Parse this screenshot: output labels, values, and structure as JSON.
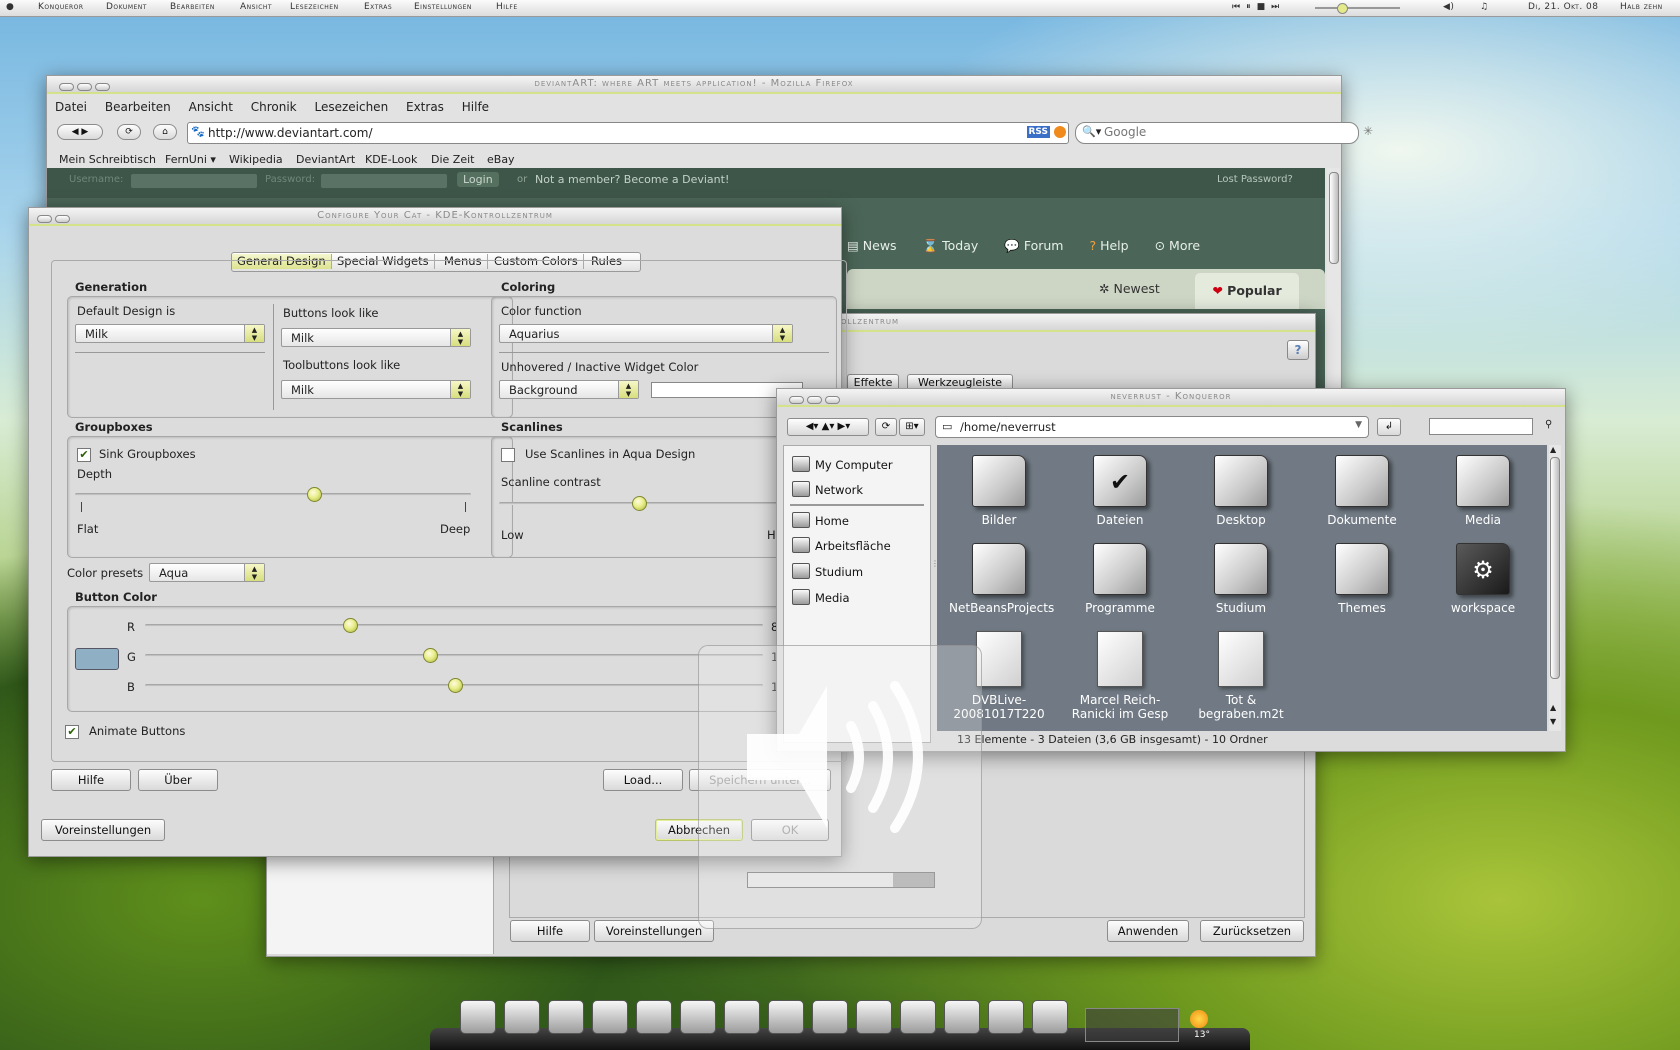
{
  "menubar": {
    "items": [
      "Konqueror",
      "Dokument",
      "Bearbeiten",
      "Ansicht",
      "Lesezeichen",
      "Extras",
      "Einstellungen",
      "Hilfe"
    ],
    "clock": "Di, 21. Okt. 08",
    "clock2": "Halb zehn"
  },
  "firefox": {
    "title": "deviantART: where ART meets application! - Mozilla Firefox",
    "menus": [
      "Datei",
      "Bearbeiten",
      "Ansicht",
      "Chronik",
      "Lesezeichen",
      "Extras",
      "Hilfe"
    ],
    "url": "http://www.deviantart.com/",
    "rss": "RSS",
    "search_placeholder": "Google",
    "bookmarks": [
      "Mein Schreibtisch",
      "FernUni ▾",
      "Wikipedia",
      "DeviantArt",
      "KDE-Look",
      "Die Zeit",
      "eBay"
    ],
    "login": {
      "username": "Username:",
      "password": "Password:",
      "button": "Login",
      "or": "or",
      "member": "Not a member? Become a Deviant!",
      "lost": "Lost Password?"
    },
    "nav": [
      "News",
      "Today",
      "Forum",
      "Help",
      "More"
    ],
    "tabs": [
      "Newest",
      "Popular"
    ]
  },
  "kcontrol_bg": {
    "title_fragment": "ollzentrum",
    "tabs": [
      "Effekte",
      "Werkzeugleiste"
    ],
    "buttons": {
      "help": "Hilfe",
      "defaults": "Voreinstellungen",
      "apply": "Anwenden",
      "reset": "Zurücksetzen"
    }
  },
  "cat": {
    "title": "Configure Your Cat - KDE-Kontrollzentrum",
    "tabs": [
      "General Design",
      "Special Widgets",
      "Menus",
      "Custom Colors",
      "Rules"
    ],
    "generation": {
      "header": "Generation",
      "default_design_label": "Default Design is",
      "default_design": "Milk",
      "buttons_label": "Buttons look like",
      "buttons": "Milk",
      "toolbuttons_label": "Toolbuttons look like",
      "toolbuttons": "Milk"
    },
    "coloring": {
      "header": "Coloring",
      "color_function_label": "Color function",
      "color_function": "Aquarius",
      "inactive_label": "Unhovered / Inactive Widget Color",
      "inactive": "Background"
    },
    "groupboxes": {
      "header": "Groupboxes",
      "sink": "Sink Groupboxes",
      "depth": "Depth",
      "flat": "Flat",
      "deep": "Deep",
      "depth_value": 0.6
    },
    "scanlines": {
      "header": "Scanlines",
      "use": "Use Scanlines in Aqua Design",
      "contrast": "Scanline contrast",
      "low": "Low",
      "high": "H",
      "contrast_value": 0.42
    },
    "color_presets_label": "Color presets",
    "color_presets": "Aqua",
    "button_color": {
      "header": "Button Color",
      "r": "R",
      "g": "G",
      "b": "B",
      "r_value": 0.33,
      "g_value": 0.46,
      "b_value": 0.5,
      "r_tail": "8",
      "g_tail": "1",
      "b_tail": "1",
      "swatch": "#8fb0c4"
    },
    "animate": "Animate Buttons",
    "buttons": {
      "help": "Hilfe",
      "about": "Über",
      "load": "Load...",
      "save": "Speichern unter...",
      "defaults": "Voreinstellungen",
      "cancel": "Abbrechen",
      "ok": "OK"
    }
  },
  "konqueror": {
    "title": "neverrust - Konqueror",
    "path": "/home/neverrust",
    "sidebar": [
      "My Computer",
      "Network",
      "Home",
      "Arbeitsfläche",
      "Studium",
      "Media"
    ],
    "items": [
      {
        "name": "Bilder",
        "kind": "folder"
      },
      {
        "name": "Dateien",
        "kind": "folder",
        "glyph": "✔"
      },
      {
        "name": "Desktop",
        "kind": "folder"
      },
      {
        "name": "Dokumente",
        "kind": "folder"
      },
      {
        "name": "Media",
        "kind": "folder"
      },
      {
        "name": "NetBeansProjects",
        "kind": "folder"
      },
      {
        "name": "Programme",
        "kind": "folder"
      },
      {
        "name": "Studium",
        "kind": "folder",
        "glyph": ""
      },
      {
        "name": "Themes",
        "kind": "folder"
      },
      {
        "name": "workspace",
        "kind": "folder-dark",
        "glyph": "⚙"
      },
      {
        "name": "DVBLive-20081017T220",
        "kind": "doc"
      },
      {
        "name": "Marcel Reich-Ranicki im Gesp",
        "kind": "doc"
      },
      {
        "name": "Tot & begraben.m2t",
        "kind": "doc"
      }
    ],
    "status": "13 Elemente - 3 Dateien (3,6 GB insgesamt) - 10 Ordner"
  },
  "volume_osd": {
    "level": 0.78
  },
  "dock": {
    "temperature": "13°"
  }
}
